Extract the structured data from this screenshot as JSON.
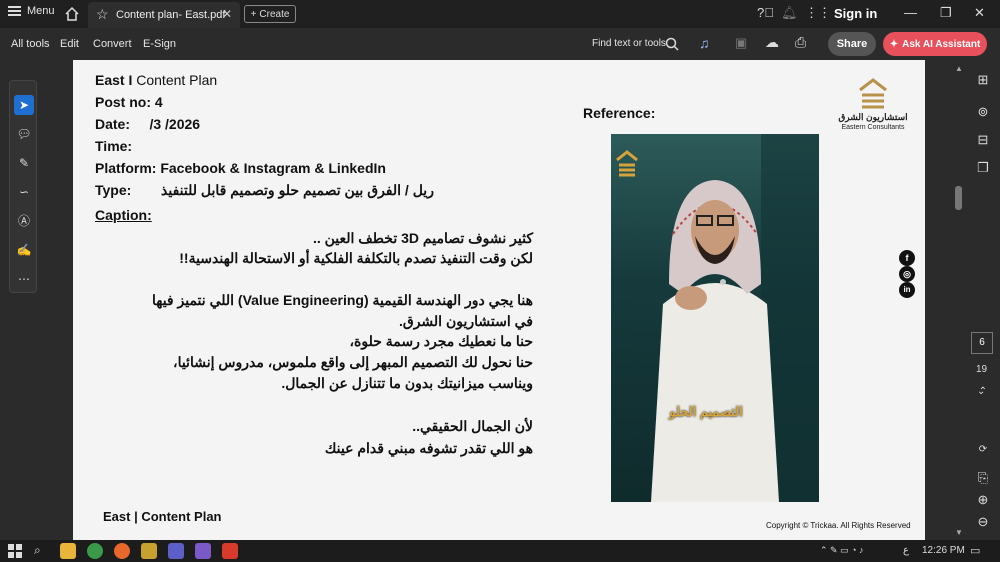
{
  "titlebar": {
    "menu_label": "Menu",
    "tab_title": "Content plan- East.pdf",
    "create_label": "Create",
    "signin_label": "Sign in"
  },
  "toolbar": {
    "items": [
      "All tools",
      "Edit",
      "Convert",
      "E-Sign"
    ],
    "find_label": "Find text or tools",
    "share_label": "Share",
    "ai_label": "Ask AI Assistant"
  },
  "page": {
    "header_bold": "East I",
    "header_rest": " Content Plan",
    "post_no": "Post no: 4",
    "date": "Date:     /3 /2026",
    "time": "Time:",
    "platform": "Platform: Facebook & Instagram & LinkedIn",
    "type_label": "Type:",
    "type_value": "ريل / الفرق بين تصميم حلو وتصميم قابل للتنفيذ",
    "caption_label": "Caption:",
    "caption_lines": [
      "كثير نشوف تصاميم 3D تخطف العين ..",
      "لكن وقت التنفيذ تصدم بالتكلفة الفلكية أو الاستحالة الهندسية!!",
      "هنا يجي دور الهندسة القيمية (Value Engineering) اللي نتميز فيها",
      "في استشاريون الشرق.",
      "حنا ما نعطيك مجرد رسمة حلوة،",
      "حنا نحول لك التصميم المبهر إلى واقع ملموس، مدروس إنشائيا،",
      "ويناسب ميزانيتك بدون ما تتنازل عن الجمال.",
      "لأن الجمال الحقيقي..",
      "هو اللي تقدر تشوفه مبني قدام عينك"
    ],
    "reference_label": "Reference:",
    "logo_arabic": "استشاريون الشرق",
    "logo_english": "Eastern Consultants",
    "photo_overlay_text": "التصميم الحلو",
    "footer_left": "East | Content Plan",
    "copyright": "Copyright © Trickaa. All Rights Reserved"
  },
  "navigation": {
    "current_page": "6",
    "total_pages": "19"
  },
  "taskbar": {
    "time": "12:26 PM",
    "lang": "ع"
  },
  "colors": {
    "accent_blue": "#1e6fd0",
    "ai_button": "#e8505b",
    "logo_gold": "#b8924a"
  }
}
